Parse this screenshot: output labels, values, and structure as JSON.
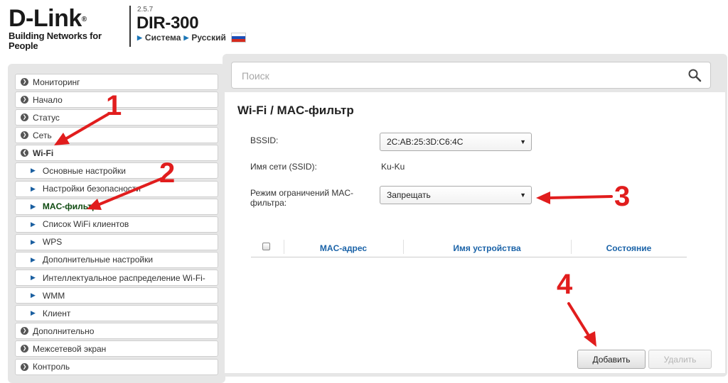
{
  "header": {
    "brand": "D-Link",
    "reg_mark": "®",
    "tagline": "Building Networks for People",
    "firmware": "2.5.7",
    "model": "DIR-300",
    "link_system": "Система",
    "link_language": "Русский"
  },
  "sidebar": {
    "items": [
      {
        "label": "Мониторинг"
      },
      {
        "label": "Начало"
      },
      {
        "label": "Статус"
      },
      {
        "label": "Сеть"
      },
      {
        "label": "Wi-Fi"
      },
      {
        "label": "Основные настройки"
      },
      {
        "label": "Настройки безопасности"
      },
      {
        "label": "MAC-фильтр"
      },
      {
        "label": "Список WiFi клиентов"
      },
      {
        "label": "WPS"
      },
      {
        "label": "Дополнительные настройки"
      },
      {
        "label": "Интеллектуальное распределение Wi-Fi-"
      },
      {
        "label": "WMM"
      },
      {
        "label": "Клиент"
      },
      {
        "label": "Дополнительно"
      },
      {
        "label": "Межсетевой экран"
      },
      {
        "label": "Контроль"
      }
    ]
  },
  "search": {
    "placeholder": "Поиск"
  },
  "main": {
    "breadcrumb": "Wi-Fi /  MAC-фильтр",
    "bssid_label": "BSSID:",
    "bssid_value": "2C:AB:25:3D:C6:4C",
    "ssid_label": "Имя сети (SSID):",
    "ssid_value": "Ku-Ku",
    "mode_label_1": "Режим ограничений MAC-",
    "mode_label_2": "фильтра:",
    "mode_value": "Запрещать",
    "table": {
      "columns": [
        "MAC-адрес",
        "Имя устройства",
        "Состояние"
      ]
    },
    "add_button": "Добавить",
    "delete_button": "Удалить"
  },
  "annotations": [
    "1",
    "2",
    "3",
    "4"
  ],
  "colors": {
    "annotation": "#e11d1d",
    "link_blue": "#1b63a8",
    "active_green": "#0e4a10"
  }
}
